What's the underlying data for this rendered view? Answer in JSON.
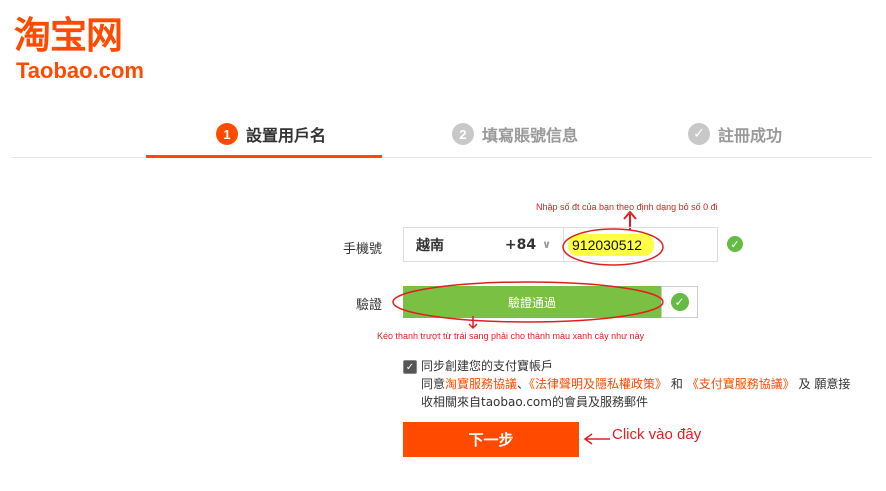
{
  "logo": {
    "chinese": "淘宝网",
    "english": "Taobao.com"
  },
  "steps": [
    {
      "number": "1",
      "label": "設置用戶名",
      "state": "active"
    },
    {
      "number": "2",
      "label": "填寫賬號信息",
      "state": "inactive"
    },
    {
      "number": "✓",
      "label": "註冊成功",
      "state": "inactive"
    }
  ],
  "form": {
    "phone_label": "手機號",
    "country": "越南",
    "country_code": "+84",
    "phone_value": "912030512",
    "verify_label": "驗證",
    "slider_text": "驗證通過"
  },
  "annotations": {
    "phone_hint": "Nhập số đt của bạn theo định dạng bỏ số 0 đi",
    "slider_hint": "Kéo thanh trượt từ trái sang phải cho thành màu xanh cây như này",
    "click_hint": "Click vào đây"
  },
  "agreement": {
    "sync_text": "同步創建您的支付寶帳戶",
    "prefix": "同意",
    "link1": "淘寶服務協議",
    "sep1": "、",
    "link2": "《法律聲明及隱私權政策》",
    "sep2": " 和 ",
    "link3": "《支付寶服務協議》",
    "suffix": " 及 願意接",
    "line3": "收相關來自taobao.com的會員及服務郵件"
  },
  "next_button": "下一步",
  "colors": {
    "brand": "#ff4a00",
    "success": "#7ac143",
    "annotation": "#e02020"
  }
}
